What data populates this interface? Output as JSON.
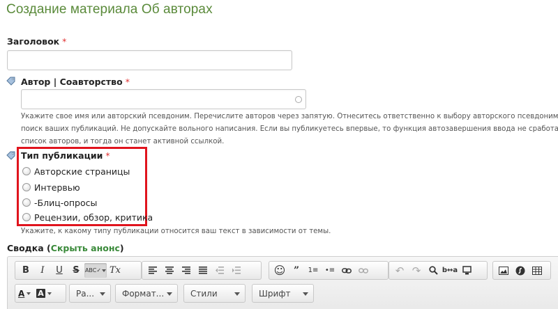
{
  "page": {
    "title": "Создание материала Об авторах"
  },
  "fields": {
    "title": {
      "label": "Заголовок",
      "required_mark": "*",
      "value": ""
    },
    "author": {
      "label": "Автор | Соавторство",
      "required_mark": "*",
      "value": "",
      "description": [
        "Укажите свое имя или авторский псевдоним. Перечислите авторов через запятую. Отнеситесь ответственно к выбору авторского псевдонима, та",
        "поиск ваших публикаций. Не допускайте вольного написания. Если вы публикуетесь впервые, то функция автозавершения ввода не сработает. Про",
        "список авторов, и тогда он станет активной ссылкой."
      ]
    },
    "pub_type": {
      "label": "Тип публикации",
      "required_mark": "*",
      "options": [
        "Авторские страницы",
        "Интервью",
        "-Блиц-опросы",
        "Рецензии, обзор, критика"
      ],
      "description": "Укажите, к какому типу публикации относится ваш текст в зависимости от темы."
    }
  },
  "summary": {
    "label": "Сводка",
    "open_paren": "(",
    "toggle_link": "Скрыть анонс",
    "close_paren": ")"
  },
  "editor": {
    "toolbar_row1": {
      "basic": [
        "B",
        "I",
        "U",
        "S",
        "ABC✓",
        "Tx"
      ],
      "align": [
        "align-left",
        "align-center",
        "align-right",
        "align-justify",
        "outdent",
        "indent"
      ],
      "insert": [
        "☺",
        "99",
        "1≡",
        "•≡",
        "link",
        "unlink"
      ],
      "tools": [
        "undo",
        "redo",
        "find",
        "replace",
        "maximize"
      ],
      "media": [
        "image",
        "flash",
        "table"
      ]
    },
    "combos": {
      "text_color": "A",
      "bg_color": "A",
      "styles_short": "Ра...",
      "format": "Формат...",
      "styles": "Стили",
      "font": "Шрифт"
    }
  },
  "colors": {
    "title_green": "#5a8a3a",
    "highlight_red": "#e0141d",
    "link_green": "#3a8a3a",
    "required_red": "#e03030"
  }
}
